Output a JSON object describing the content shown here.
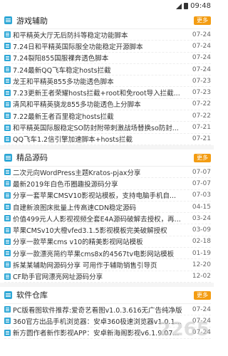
{
  "status": {
    "time": "09:48"
  },
  "sections": [
    {
      "title": "游戏辅助",
      "more": "更多",
      "items": [
        {
          "title": "和平精英大厅无后防抖等稳定功能脚本",
          "date": "07-24"
        },
        {
          "title": "7.24日和平精英国际服全功能稳定开源脚本",
          "date": "07-24"
        },
        {
          "title": "7.24裂阳855国服裸奔透色脚本",
          "date": "07-24"
        },
        {
          "title": "7.24最新QQ飞车稳定hosts拦截",
          "date": "07-24"
        },
        {
          "title": "龙王和平精英855多功能透色脚本",
          "date": "07-23"
        },
        {
          "title": "7.23更新王者荣耀hosts拦截+root和免root导入拦截...",
          "date": "07-23"
        },
        {
          "title": "清风和平精英骁龙855多功能透色上分脚本",
          "date": "07-22"
        },
        {
          "title": "7.22最新王者百里稳定hosts拦截",
          "date": "07-22"
        },
        {
          "title": "和平精英国际服稳定SO防封附带刺激战场替换so防封...",
          "date": "07-21"
        },
        {
          "title": "QQ飞车1.2信引擎加速脚本+hosts拦截",
          "date": "07-21"
        }
      ]
    },
    {
      "title": "精品源码",
      "more": "更多",
      "items": [
        {
          "title": "二次元向WordPress主题Kratos-pjax分享",
          "date": "07-07"
        },
        {
          "title": "最新2019年白色币圈趣投源码分享",
          "date": "07-07"
        },
        {
          "title": "分享一套苹果CMSV10影视站模板，支持电脑手机自...",
          "date": "07-03"
        },
        {
          "title": "自建新浪图床批量上传高速CDN稳定源码",
          "date": "04-15"
        },
        {
          "title": "价值499元人人影视视频全套E4A源码破解去授权，再...",
          "date": "03-24"
        },
        {
          "title": "苹果CMSv10大橙vfed3.1.5影视模板完美破解授权",
          "date": "03-09"
        },
        {
          "title": "分享一款苹果cms v10的精美影视网站模板",
          "date": "02-18"
        },
        {
          "title": "分享一款漂亮简约苹果cms8x的4567tv电影网站模板",
          "date": "01-19"
        },
        {
          "title": "拆某某辅助网源码分享 可用作于辅助销售引导页",
          "date": "12-20"
        },
        {
          "title": "CF助手官网漂亮网址源码分享",
          "date": "12-02"
        }
      ]
    },
    {
      "title": "软件仓库",
      "more": "更多",
      "items": [
        {
          "title": "PC版看图软件推荐:爱奇艺看图v1.0.3.616无广告纯净版",
          "date": "07-24"
        },
        {
          "title": "360官方出品手机浏览器：安卓360极速浏览器v1.0.1...",
          "date": "07-24"
        },
        {
          "title": "新方圆作者新作影视APP：安卓新海阁影视v6.1.9.07...",
          "date": "07-24"
        }
      ]
    }
  ],
  "watermark": "2265"
}
